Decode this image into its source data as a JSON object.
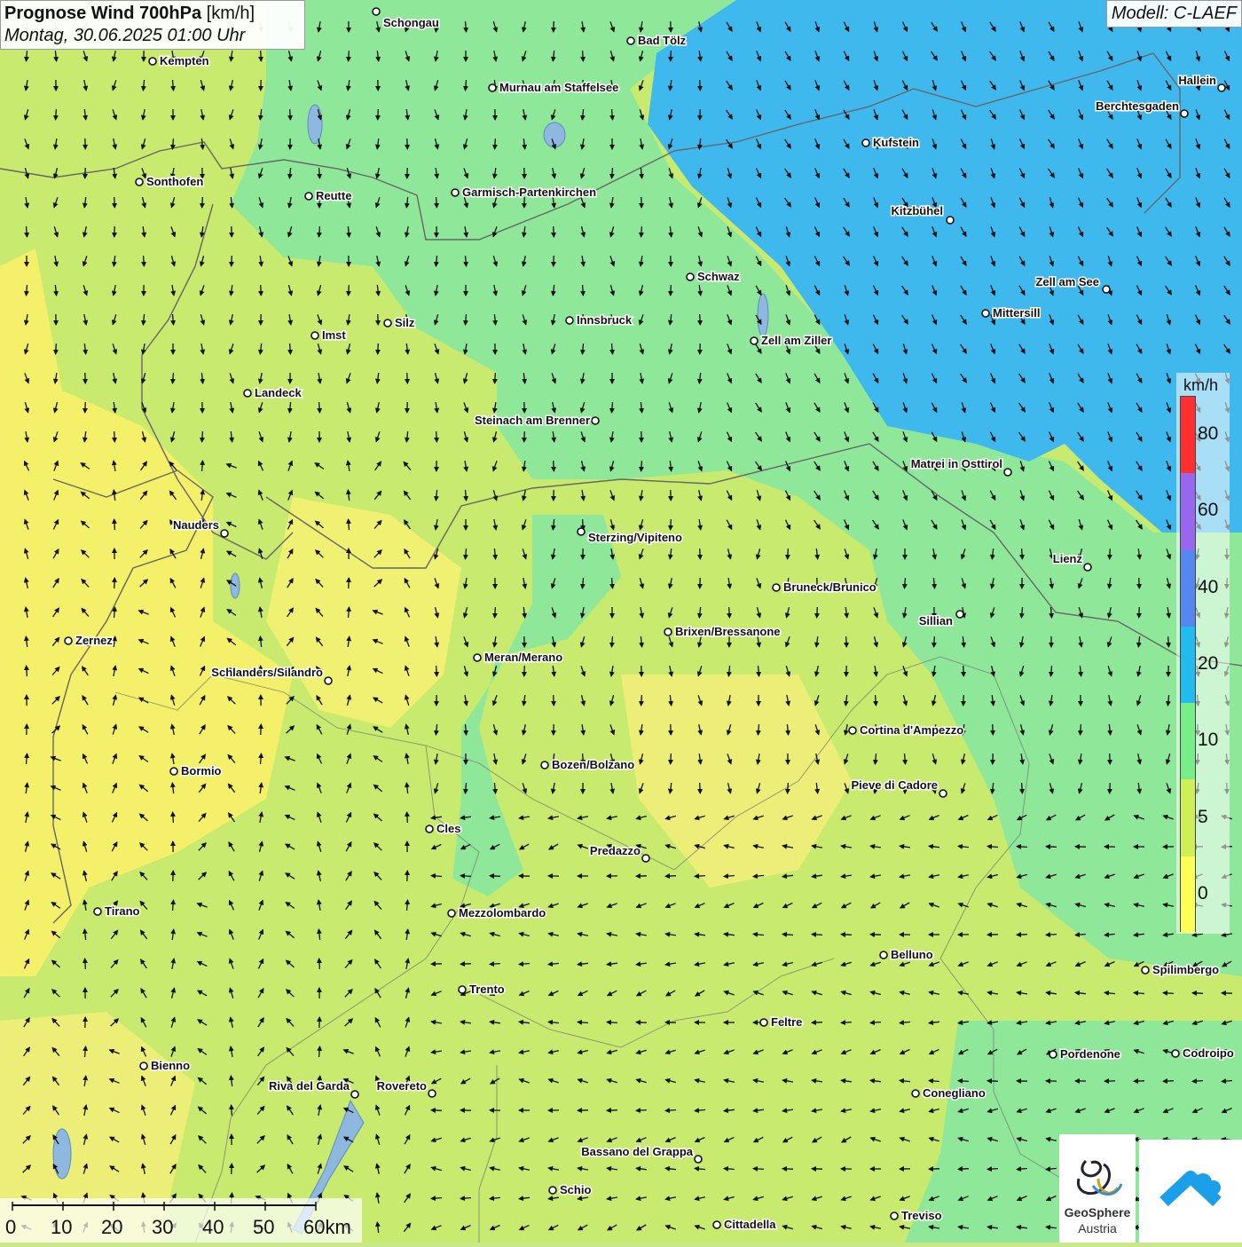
{
  "header": {
    "title_bold": "Prognose Wind 700hPa",
    "title_unit": " [km/h]",
    "datetime": "Montag, 30.06.2025 01:00 Uhr"
  },
  "model": "Modell: C-LAEF",
  "legend": {
    "unit": "km/h",
    "ticks": [
      "80",
      "60",
      "40",
      "20",
      "10",
      "5",
      "0"
    ],
    "colors": [
      "#ff3030",
      "#9966ee",
      "#5588ee",
      "#22bbee",
      "#77ee88",
      "#ccf055",
      "#ffff55"
    ]
  },
  "scale": {
    "labels": [
      "0",
      "10",
      "20",
      "30",
      "40",
      "50",
      "60km"
    ]
  },
  "logo": {
    "line1": "GeoSphere",
    "line2": "Austria"
  },
  "colors": {
    "wind_0_5": "#f5f06a",
    "wind_5_10": "#c8ea6e",
    "wind_10_20": "#8fe89a",
    "wind_20_40": "#3fb8ee",
    "border": "#666666",
    "lake": "#8fb8e0"
  },
  "cities": [
    {
      "name": "Schongau"
    },
    {
      "name": "Bad Tölz"
    },
    {
      "name": "Kempten"
    },
    {
      "name": "Murnau am Staffelsee"
    },
    {
      "name": "Hallein"
    },
    {
      "name": "Berchtesgaden"
    },
    {
      "name": "Kufstein"
    },
    {
      "name": "Sonthofen"
    },
    {
      "name": "Reutte"
    },
    {
      "name": "Garmisch-Partenkirchen"
    },
    {
      "name": "Kitzbühel"
    },
    {
      "name": "Schwaz"
    },
    {
      "name": "Zell am See"
    },
    {
      "name": "Innsbruck"
    },
    {
      "name": "Mittersill"
    },
    {
      "name": "Silz"
    },
    {
      "name": "Imst"
    },
    {
      "name": "Zell am Ziller"
    },
    {
      "name": "Landeck"
    },
    {
      "name": "Steinach am Brenner"
    },
    {
      "name": "Matrei in Osttirol"
    },
    {
      "name": "Nauders"
    },
    {
      "name": "Sterzing/Vipiteno"
    },
    {
      "name": "Lienz"
    },
    {
      "name": "Bruneck/Brunico"
    },
    {
      "name": "Sillian"
    },
    {
      "name": "Brixen/Bressanone"
    },
    {
      "name": "Zernez"
    },
    {
      "name": "Meran/Merano"
    },
    {
      "name": "Schlanders/Silandro"
    },
    {
      "name": "Cortina d'Ampezzo"
    },
    {
      "name": "Bormio"
    },
    {
      "name": "Bozen/Bolzano"
    },
    {
      "name": "Pieve di Cadore"
    },
    {
      "name": "Cles"
    },
    {
      "name": "Predazzo"
    },
    {
      "name": "Tirano"
    },
    {
      "name": "Mezzolombardo"
    },
    {
      "name": "Belluno"
    },
    {
      "name": "Spilimbergo"
    },
    {
      "name": "Trento"
    },
    {
      "name": "Feltre"
    },
    {
      "name": "Pordenone"
    },
    {
      "name": "Codroipo"
    },
    {
      "name": "Bienno"
    },
    {
      "name": "Riva del Garda"
    },
    {
      "name": "Rovereto"
    },
    {
      "name": "Conegliano"
    },
    {
      "name": "Bassano del Grappa"
    },
    {
      "name": "Schio"
    },
    {
      "name": "Treviso"
    },
    {
      "name": "Cittadella"
    }
  ]
}
